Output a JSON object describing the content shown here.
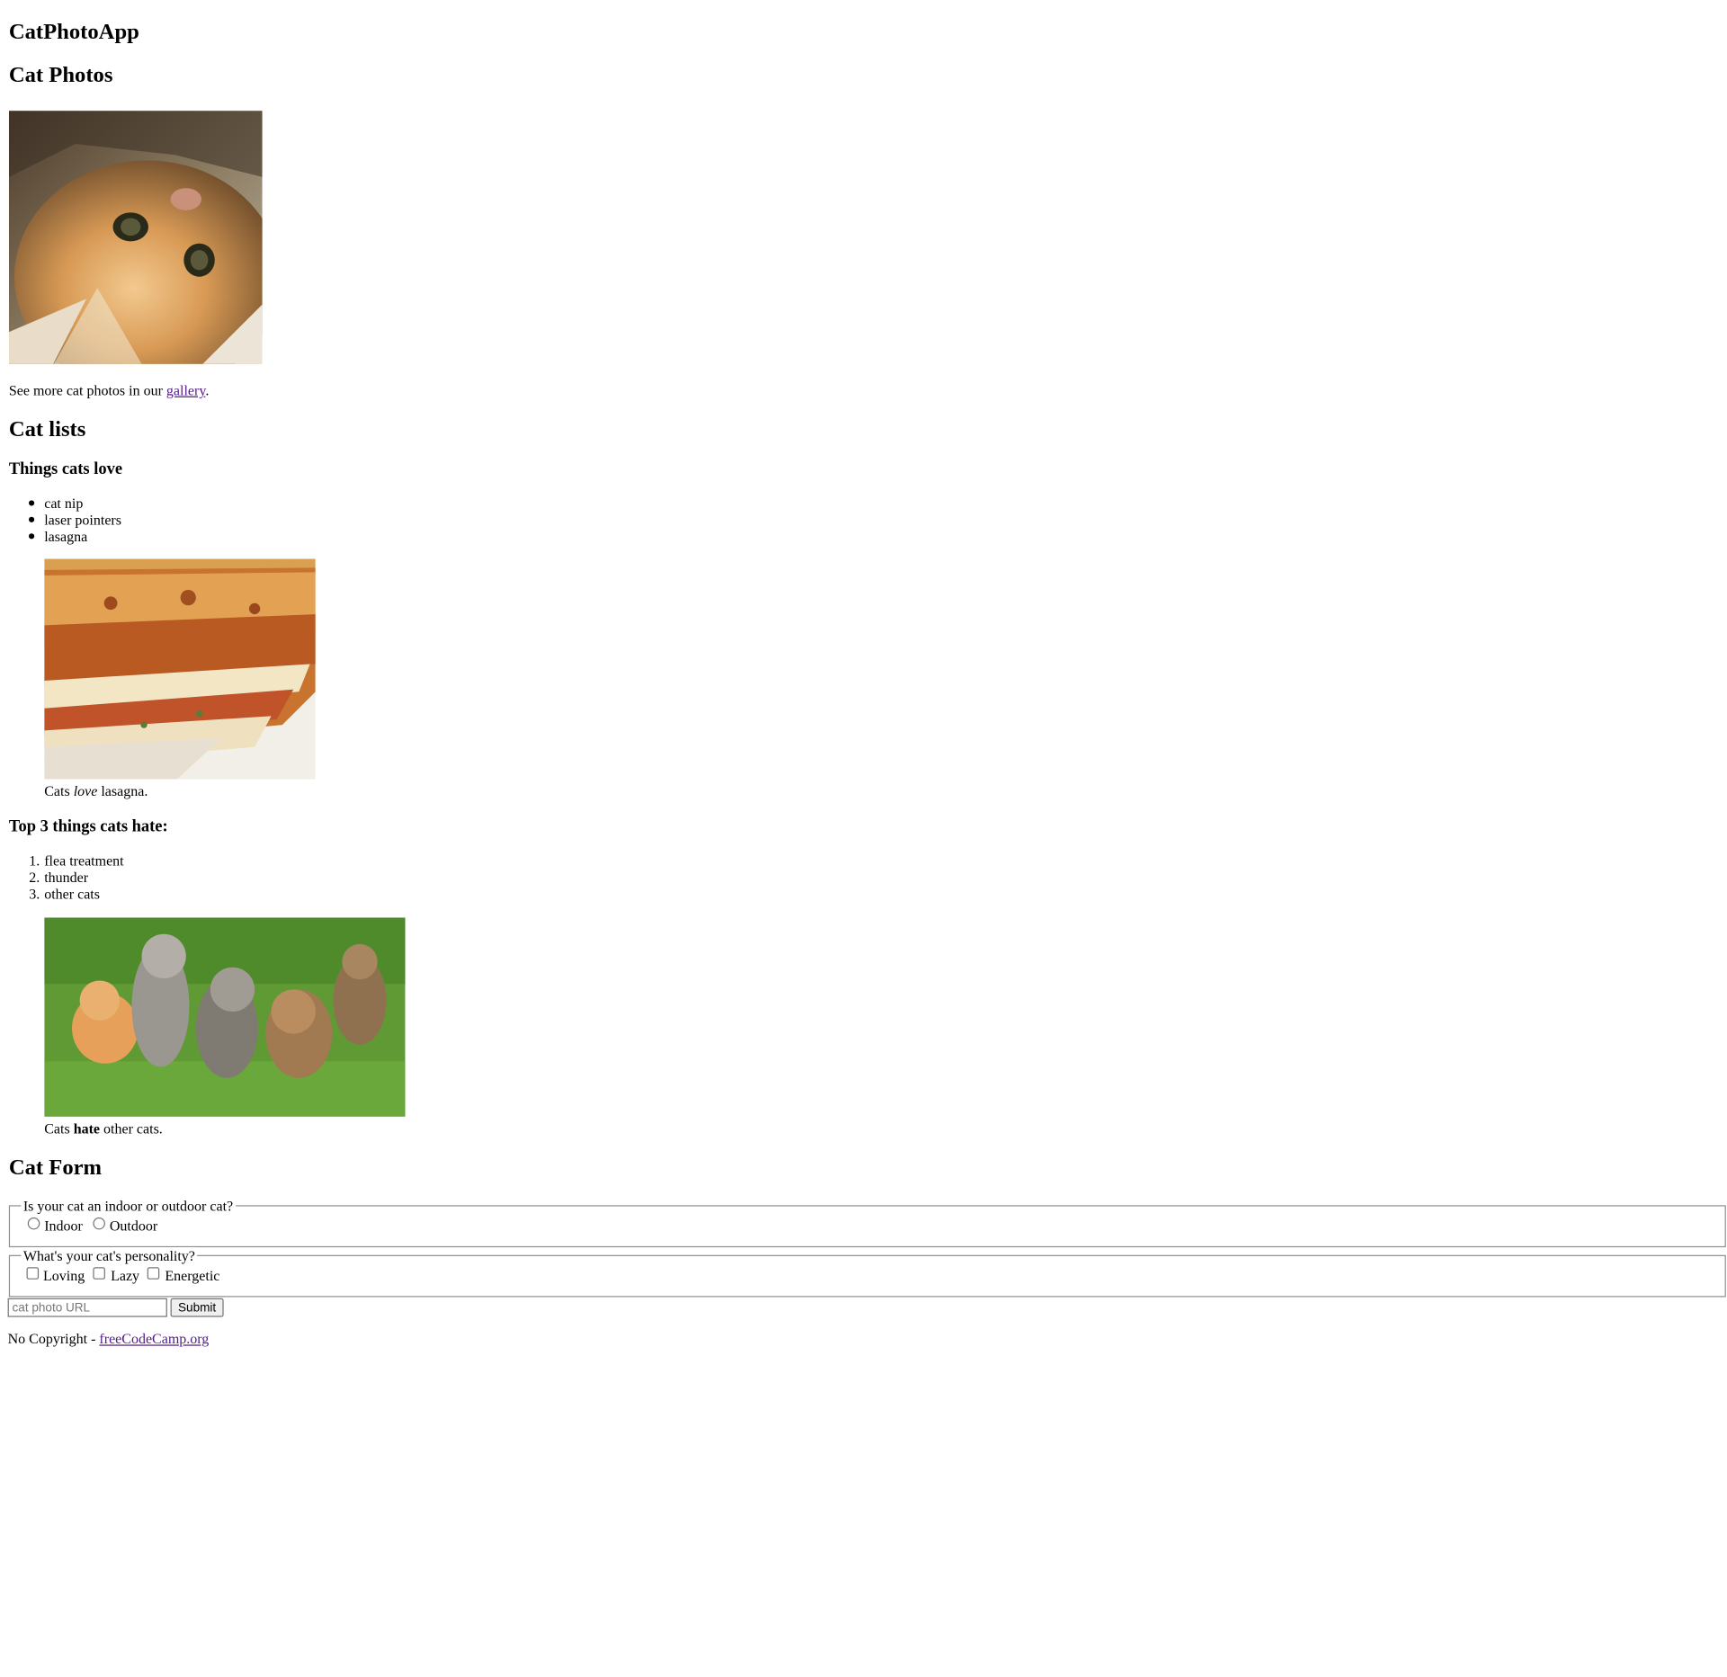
{
  "main": {
    "app_title": "CatPhotoApp",
    "photos_section": {
      "heading": "Cat Photos",
      "image_icon": "relaxing-cat-image",
      "gallery_text_before": "See more cat photos in our ",
      "gallery_link": "gallery",
      "gallery_text_after": "."
    },
    "lists_section": {
      "heading": "Cat lists",
      "love": {
        "heading": "Things cats love",
        "items": [
          "cat nip",
          "laser pointers",
          "lasagna"
        ],
        "image_icon": "lasagna-image",
        "caption_before": "Cats ",
        "caption_emphasis": "love",
        "caption_after": " lasagna."
      },
      "hate": {
        "heading": "Top 3 things cats hate:",
        "items": [
          "flea treatment",
          "thunder",
          "other cats"
        ],
        "numbers": [
          "1.",
          "2.",
          "3."
        ],
        "image_icon": "cats-image",
        "caption_before": "Cats ",
        "caption_strong": "hate",
        "caption_after": " other cats."
      }
    },
    "form_section": {
      "heading": "Cat Form",
      "location": {
        "legend": "Is your cat an indoor or outdoor cat?",
        "options": [
          "Indoor",
          "Outdoor"
        ]
      },
      "personality": {
        "legend": "What's your cat's personality?",
        "options": [
          "Loving",
          "Lazy",
          "Energetic"
        ]
      },
      "url_placeholder": "cat photo URL",
      "submit_label": "Submit"
    }
  },
  "footer": {
    "text": "No Copyright - ",
    "link": "freeCodeCamp.org"
  },
  "colors": {
    "link_visited": "#551a8b",
    "text": "#000000",
    "background": "#ffffff"
  }
}
